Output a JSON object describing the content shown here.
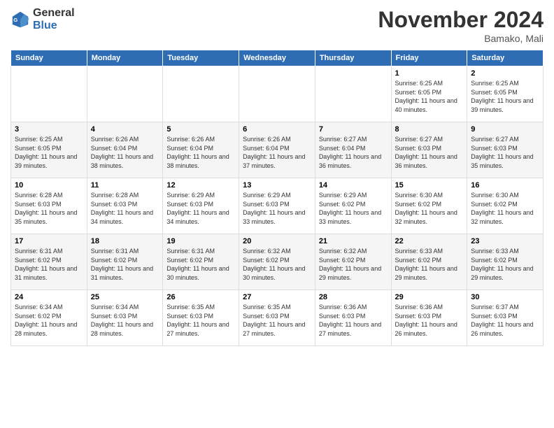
{
  "logo": {
    "line1": "General",
    "line2": "Blue"
  },
  "title": "November 2024",
  "location": "Bamako, Mali",
  "days_of_week": [
    "Sunday",
    "Monday",
    "Tuesday",
    "Wednesday",
    "Thursday",
    "Friday",
    "Saturday"
  ],
  "weeks": [
    [
      {
        "day": "",
        "info": ""
      },
      {
        "day": "",
        "info": ""
      },
      {
        "day": "",
        "info": ""
      },
      {
        "day": "",
        "info": ""
      },
      {
        "day": "",
        "info": ""
      },
      {
        "day": "1",
        "info": "Sunrise: 6:25 AM\nSunset: 6:05 PM\nDaylight: 11 hours and 40 minutes."
      },
      {
        "day": "2",
        "info": "Sunrise: 6:25 AM\nSunset: 6:05 PM\nDaylight: 11 hours and 39 minutes."
      }
    ],
    [
      {
        "day": "3",
        "info": "Sunrise: 6:25 AM\nSunset: 6:05 PM\nDaylight: 11 hours and 39 minutes."
      },
      {
        "day": "4",
        "info": "Sunrise: 6:26 AM\nSunset: 6:04 PM\nDaylight: 11 hours and 38 minutes."
      },
      {
        "day": "5",
        "info": "Sunrise: 6:26 AM\nSunset: 6:04 PM\nDaylight: 11 hours and 38 minutes."
      },
      {
        "day": "6",
        "info": "Sunrise: 6:26 AM\nSunset: 6:04 PM\nDaylight: 11 hours and 37 minutes."
      },
      {
        "day": "7",
        "info": "Sunrise: 6:27 AM\nSunset: 6:04 PM\nDaylight: 11 hours and 36 minutes."
      },
      {
        "day": "8",
        "info": "Sunrise: 6:27 AM\nSunset: 6:03 PM\nDaylight: 11 hours and 36 minutes."
      },
      {
        "day": "9",
        "info": "Sunrise: 6:27 AM\nSunset: 6:03 PM\nDaylight: 11 hours and 35 minutes."
      }
    ],
    [
      {
        "day": "10",
        "info": "Sunrise: 6:28 AM\nSunset: 6:03 PM\nDaylight: 11 hours and 35 minutes."
      },
      {
        "day": "11",
        "info": "Sunrise: 6:28 AM\nSunset: 6:03 PM\nDaylight: 11 hours and 34 minutes."
      },
      {
        "day": "12",
        "info": "Sunrise: 6:29 AM\nSunset: 6:03 PM\nDaylight: 11 hours and 34 minutes."
      },
      {
        "day": "13",
        "info": "Sunrise: 6:29 AM\nSunset: 6:03 PM\nDaylight: 11 hours and 33 minutes."
      },
      {
        "day": "14",
        "info": "Sunrise: 6:29 AM\nSunset: 6:02 PM\nDaylight: 11 hours and 33 minutes."
      },
      {
        "day": "15",
        "info": "Sunrise: 6:30 AM\nSunset: 6:02 PM\nDaylight: 11 hours and 32 minutes."
      },
      {
        "day": "16",
        "info": "Sunrise: 6:30 AM\nSunset: 6:02 PM\nDaylight: 11 hours and 32 minutes."
      }
    ],
    [
      {
        "day": "17",
        "info": "Sunrise: 6:31 AM\nSunset: 6:02 PM\nDaylight: 11 hours and 31 minutes."
      },
      {
        "day": "18",
        "info": "Sunrise: 6:31 AM\nSunset: 6:02 PM\nDaylight: 11 hours and 31 minutes."
      },
      {
        "day": "19",
        "info": "Sunrise: 6:31 AM\nSunset: 6:02 PM\nDaylight: 11 hours and 30 minutes."
      },
      {
        "day": "20",
        "info": "Sunrise: 6:32 AM\nSunset: 6:02 PM\nDaylight: 11 hours and 30 minutes."
      },
      {
        "day": "21",
        "info": "Sunrise: 6:32 AM\nSunset: 6:02 PM\nDaylight: 11 hours and 29 minutes."
      },
      {
        "day": "22",
        "info": "Sunrise: 6:33 AM\nSunset: 6:02 PM\nDaylight: 11 hours and 29 minutes."
      },
      {
        "day": "23",
        "info": "Sunrise: 6:33 AM\nSunset: 6:02 PM\nDaylight: 11 hours and 29 minutes."
      }
    ],
    [
      {
        "day": "24",
        "info": "Sunrise: 6:34 AM\nSunset: 6:02 PM\nDaylight: 11 hours and 28 minutes."
      },
      {
        "day": "25",
        "info": "Sunrise: 6:34 AM\nSunset: 6:03 PM\nDaylight: 11 hours and 28 minutes."
      },
      {
        "day": "26",
        "info": "Sunrise: 6:35 AM\nSunset: 6:03 PM\nDaylight: 11 hours and 27 minutes."
      },
      {
        "day": "27",
        "info": "Sunrise: 6:35 AM\nSunset: 6:03 PM\nDaylight: 11 hours and 27 minutes."
      },
      {
        "day": "28",
        "info": "Sunrise: 6:36 AM\nSunset: 6:03 PM\nDaylight: 11 hours and 27 minutes."
      },
      {
        "day": "29",
        "info": "Sunrise: 6:36 AM\nSunset: 6:03 PM\nDaylight: 11 hours and 26 minutes."
      },
      {
        "day": "30",
        "info": "Sunrise: 6:37 AM\nSunset: 6:03 PM\nDaylight: 11 hours and 26 minutes."
      }
    ]
  ]
}
